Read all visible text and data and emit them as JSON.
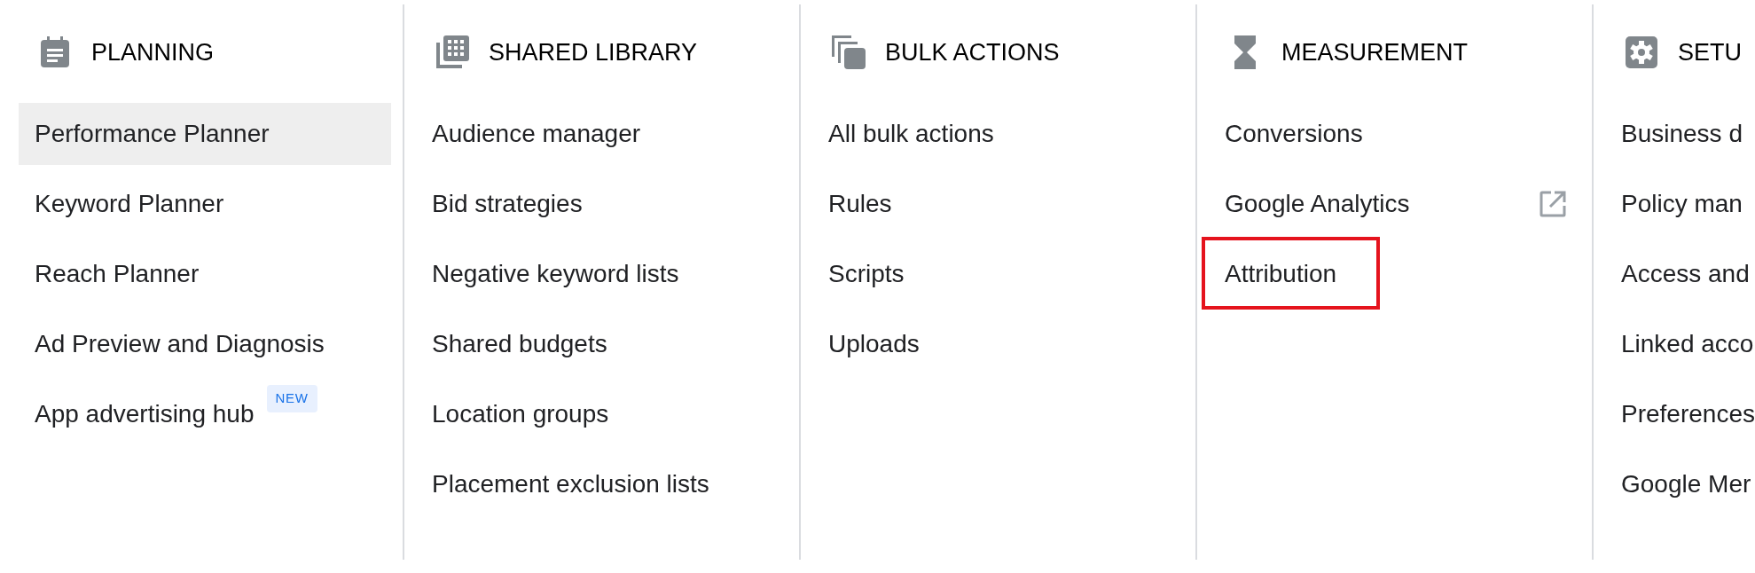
{
  "columns": [
    {
      "title": "PLANNING",
      "items": [
        {
          "label": "Performance Planner",
          "selected": true
        },
        {
          "label": "Keyword Planner",
          "selected": false
        },
        {
          "label": "Reach Planner",
          "selected": false
        },
        {
          "label": "Ad Preview and Diagnosis",
          "selected": false
        },
        {
          "label": "App advertising hub",
          "selected": false,
          "badge": "NEW"
        }
      ]
    },
    {
      "title": "SHARED LIBRARY",
      "items": [
        {
          "label": "Audience manager",
          "selected": false
        },
        {
          "label": "Bid strategies",
          "selected": false
        },
        {
          "label": "Negative keyword lists",
          "selected": false
        },
        {
          "label": "Shared budgets",
          "selected": false
        },
        {
          "label": "Location groups",
          "selected": false
        },
        {
          "label": "Placement exclusion lists",
          "selected": false
        }
      ]
    },
    {
      "title": "BULK ACTIONS",
      "items": [
        {
          "label": "All bulk actions",
          "selected": false
        },
        {
          "label": "Rules",
          "selected": false
        },
        {
          "label": "Scripts",
          "selected": false
        },
        {
          "label": "Uploads",
          "selected": false
        }
      ]
    },
    {
      "title": "MEASUREMENT",
      "items": [
        {
          "label": "Conversions",
          "selected": false,
          "kind": "link",
          "outlined": false
        },
        {
          "label": "Google Analytics",
          "selected": false,
          "kind": "external",
          "outlined": false
        },
        {
          "label": "Attribution",
          "selected": false,
          "kind": "link",
          "outlined": true
        }
      ]
    },
    {
      "title": "SETU",
      "items": [
        {
          "label": "Business d",
          "selected": false
        },
        {
          "label": "Policy man",
          "selected": false
        },
        {
          "label": "Access and",
          "selected": false
        },
        {
          "label": "Linked acco",
          "selected": false
        },
        {
          "label": "Preferences",
          "selected": false
        },
        {
          "label": "Google Mer",
          "selected": false
        }
      ]
    }
  ]
}
